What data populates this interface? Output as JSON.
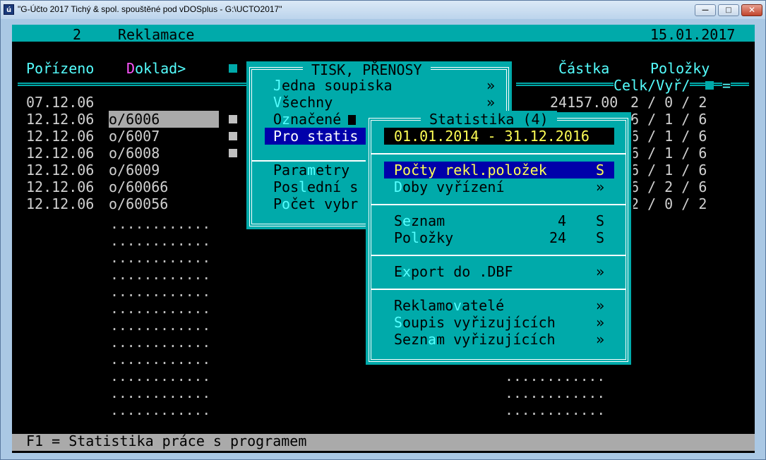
{
  "window": {
    "title": "\"G-Účto 2017 Tichý & spol. spouštěné pod vDOSplus - G:\\UCTO2017\"",
    "icon_glyph": "ú",
    "buttons": {
      "minimize": "—",
      "maximize": "□",
      "close": "✕"
    }
  },
  "header": {
    "number": "2",
    "module": "Reklamace",
    "date": "15.01.2017"
  },
  "columns": {
    "porizeno": "Pořízeno",
    "doklad_first": "D",
    "doklad_rest": "oklad>",
    "castka": "Částka",
    "polozky": "Položky",
    "celk_vyr": "Celk/Vyř/",
    "eq": "="
  },
  "rows": [
    {
      "date": "07.12.06",
      "doc": "",
      "amount": "24157.00",
      "counts": "2 / 0 / 2"
    },
    {
      "date": "12.12.06",
      "doc": "o/6006",
      "amount": "",
      "counts": "6 / 1 / 6"
    },
    {
      "date": "12.12.06",
      "doc": "o/6007",
      "amount": "",
      "counts": "6 / 1 / 6"
    },
    {
      "date": "12.12.06",
      "doc": "o/6008",
      "amount": "",
      "counts": "6 / 1 / 6"
    },
    {
      "date": "12.12.06",
      "doc": "o/6009",
      "amount": "",
      "counts": "6 / 1 / 6"
    },
    {
      "date": "12.12.06",
      "doc": "o/60066",
      "amount": "",
      "counts": "6 / 2 / 6"
    },
    {
      "date": "12.12.06",
      "doc": "o/60056",
      "amount": "",
      "counts": "2 / 0 / 2"
    }
  ],
  "dots_row": "............",
  "tisk_menu": {
    "title": " TISK, PŘENOSY ",
    "items": [
      {
        "hot": "J",
        "rest": "edna soupiska",
        "suffix": "»"
      },
      {
        "hot": "V",
        "rest": "šechny",
        "suffix": "»"
      },
      {
        "pre": "O",
        "hot": "z",
        "rest": "načené",
        "suffix": ""
      },
      {
        "label": "Pro statis",
        "suffix": ""
      },
      {
        "pre": "Para",
        "hot": "m",
        "rest": "etry",
        "suffix": ""
      },
      {
        "pre": "Pos",
        "hot": "l",
        "rest": "ední s",
        "suffix": ""
      },
      {
        "pre": "P",
        "hot": "o",
        "rest": "čet vybr",
        "suffix": ""
      }
    ]
  },
  "stat_menu": {
    "title": " Statistika (4) ",
    "range": "01.01.2014 - 31.12.2016",
    "items": [
      {
        "label": "Počty rekl.položek",
        "value": "",
        "suffix": "S"
      },
      {
        "hot": "D",
        "rest": "oby vyřízení",
        "value": "",
        "suffix": "»"
      },
      {
        "pre": "S",
        "hot": "e",
        "rest": "znam",
        "value": "4",
        "suffix": "S"
      },
      {
        "pre": "Po",
        "hot": "l",
        "rest": "ožky",
        "value": "24",
        "suffix": "S"
      },
      {
        "pre": "E",
        "hot": "x",
        "rest": "port do .DBF",
        "value": "",
        "suffix": "»"
      },
      {
        "pre": "Reklamo",
        "hot": "v",
        "rest": "atelé",
        "value": "",
        "suffix": "»"
      },
      {
        "hot": "S",
        "rest": "oupis vyřizujících",
        "value": "",
        "suffix": "»"
      },
      {
        "pre": "Sezn",
        "hot": "a",
        "rest": "m vyřizujících",
        "value": "",
        "suffix": "»"
      }
    ]
  },
  "status": "F1 = Statistika práce s programem"
}
